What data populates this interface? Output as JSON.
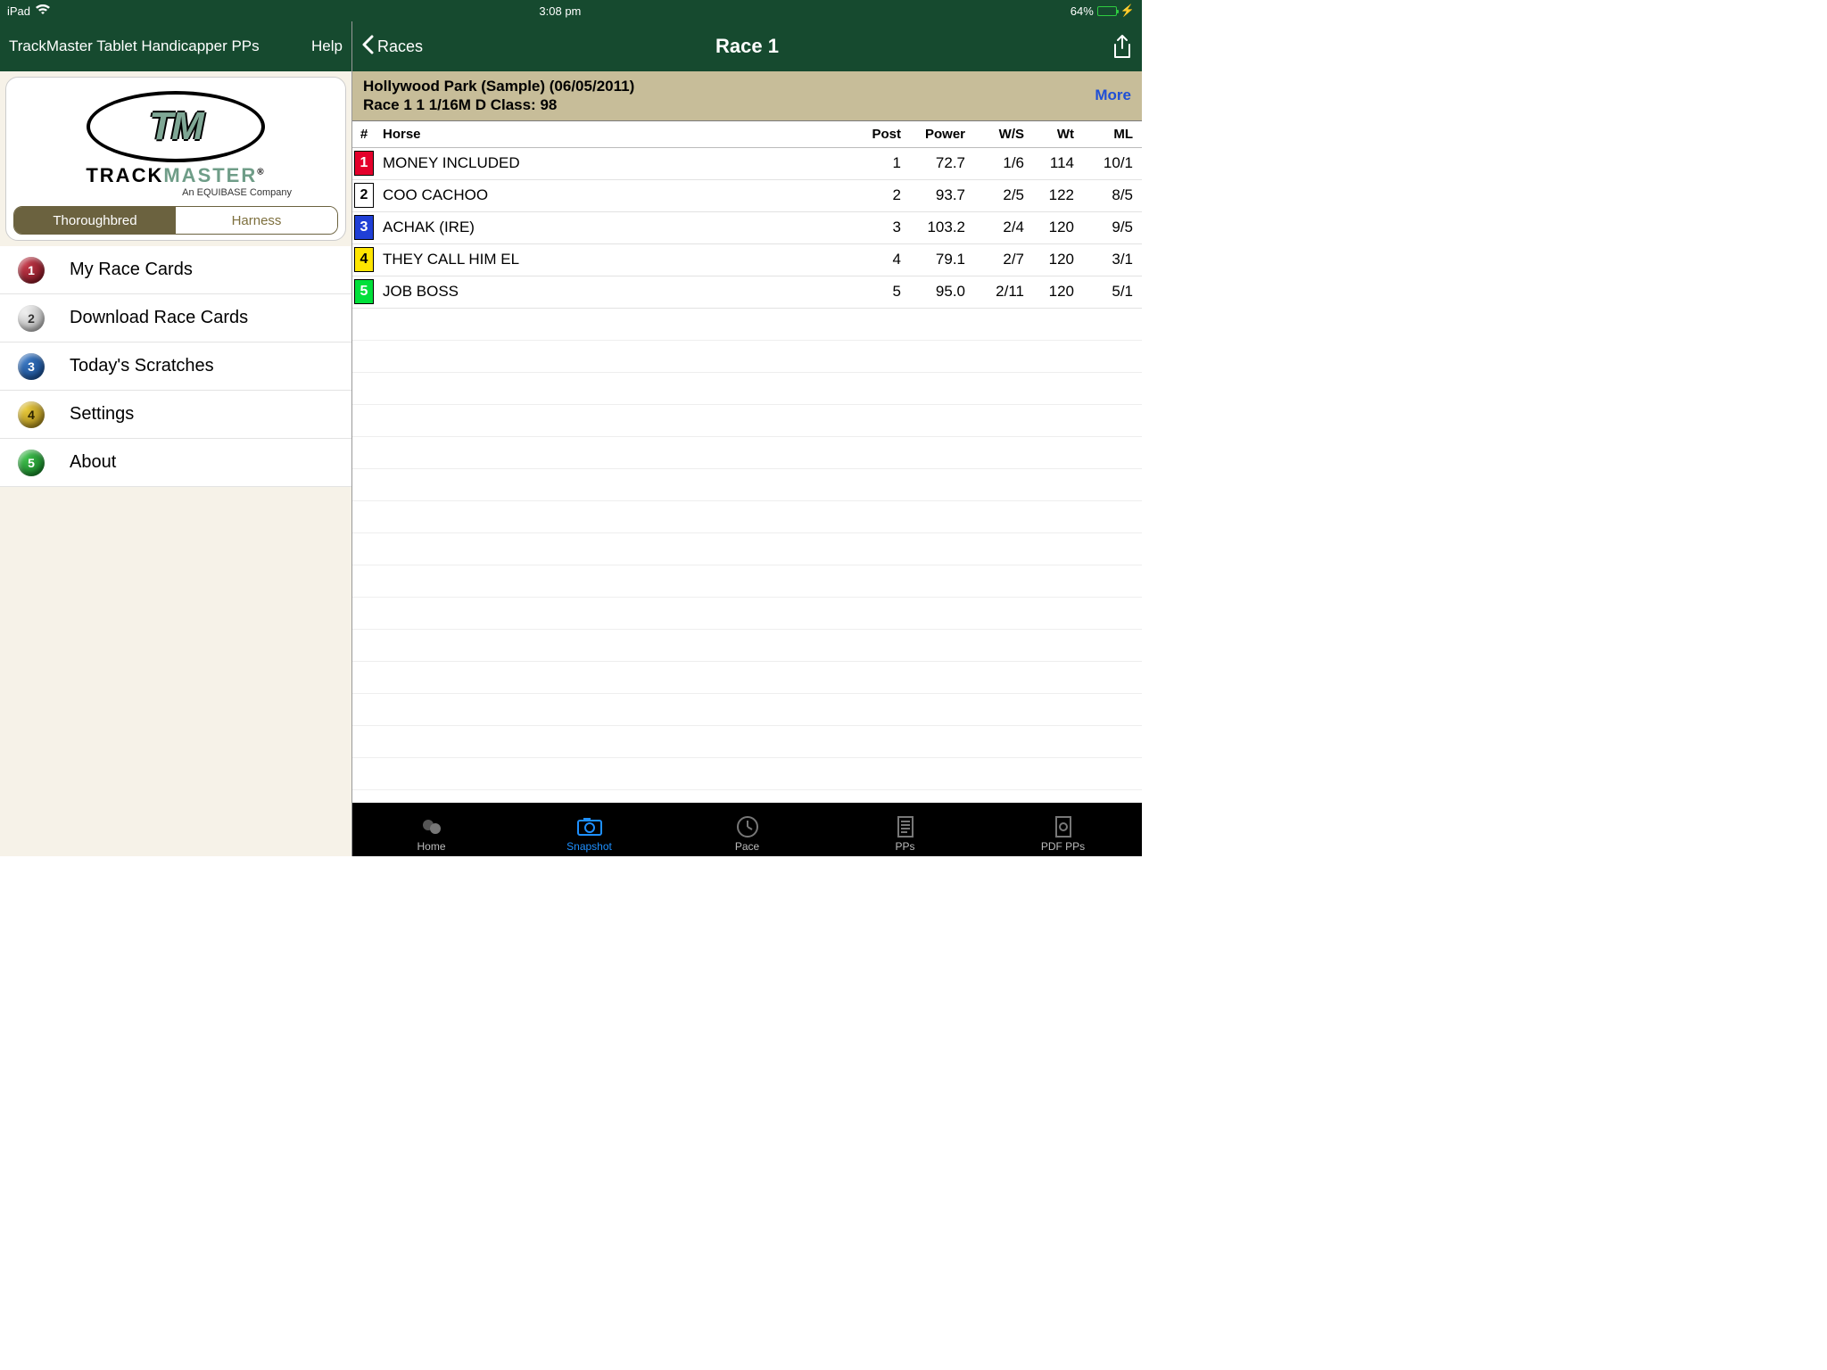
{
  "status": {
    "device": "iPad",
    "time": "3:08 pm",
    "battery_pct": "64%"
  },
  "sidebar": {
    "title": "TrackMaster Tablet Handicapper PPs",
    "help": "Help",
    "logo": {
      "word1": "TRACK",
      "word2": "MASTER",
      "reg": "®",
      "subline": "An EQUIBASE Company"
    },
    "segments": {
      "left": "Thoroughbred",
      "right": "Harness"
    },
    "menu": [
      {
        "num": "1",
        "label": "My Race Cards"
      },
      {
        "num": "2",
        "label": "Download Race Cards"
      },
      {
        "num": "3",
        "label": "Today's Scratches"
      },
      {
        "num": "4",
        "label": "Settings"
      },
      {
        "num": "5",
        "label": "About"
      }
    ]
  },
  "main": {
    "back": "Races",
    "title": "Race 1",
    "info_line1": "Hollywood Park (Sample) (06/05/2011)",
    "info_line2": "Race 1 1 1/16M D Class: 98",
    "more": "More",
    "headers": {
      "num": "#",
      "horse": "Horse",
      "post": "Post",
      "power": "Power",
      "ws": "W/S",
      "wt": "Wt",
      "ml": "ML"
    },
    "rows": [
      {
        "n": "1",
        "horse": "MONEY INCLUDED",
        "post": "1",
        "power": "72.7",
        "ws": "1/6",
        "wt": "114",
        "ml": "10/1"
      },
      {
        "n": "2",
        "horse": "COO CACHOO",
        "post": "2",
        "power": "93.7",
        "ws": "2/5",
        "wt": "122",
        "ml": "8/5"
      },
      {
        "n": "3",
        "horse": "ACHAK (IRE)",
        "post": "3",
        "power": "103.2",
        "ws": "2/4",
        "wt": "120",
        "ml": "9/5"
      },
      {
        "n": "4",
        "horse": "THEY CALL HIM EL",
        "post": "4",
        "power": "79.1",
        "ws": "2/7",
        "wt": "120",
        "ml": "3/1"
      },
      {
        "n": "5",
        "horse": "JOB BOSS",
        "post": "5",
        "power": "95.0",
        "ws": "2/11",
        "wt": "120",
        "ml": "5/1"
      }
    ]
  },
  "tabs": {
    "home": "Home",
    "snapshot": "Snapshot",
    "pace": "Pace",
    "pps": "PPs",
    "pdf": "PDF PPs"
  }
}
